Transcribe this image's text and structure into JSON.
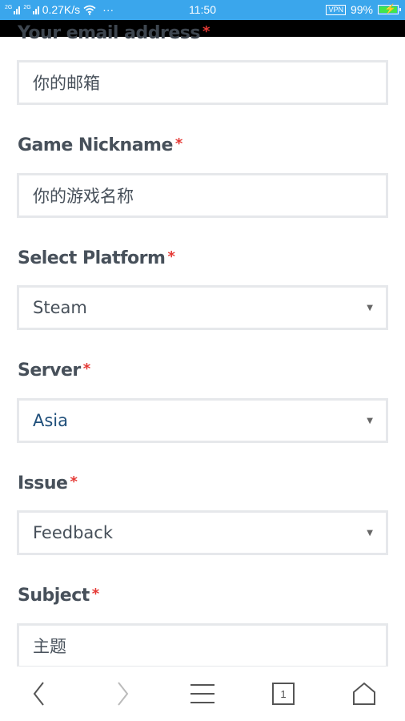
{
  "status_bar": {
    "sim1": "2G",
    "sim2": "2G",
    "network_speed": "0.27K/s",
    "more": "···",
    "time": "11:50",
    "vpn": "VPN",
    "battery": "99%"
  },
  "form": {
    "email": {
      "label": "Your email address",
      "placeholder": "你的邮箱"
    },
    "nickname": {
      "label": "Game Nickname",
      "placeholder": "你的游戏名称"
    },
    "platform": {
      "label": "Select Platform",
      "value": "Steam"
    },
    "server": {
      "label": "Server",
      "value": "Asia"
    },
    "issue": {
      "label": "Issue",
      "value": "Feedback"
    },
    "subject": {
      "label": "Subject",
      "placeholder": "主题"
    },
    "required_mark": "*"
  },
  "nav": {
    "tab_count": "1",
    "icons": [
      "back-icon",
      "forward-icon",
      "menu-icon",
      "tabs-icon",
      "home-icon"
    ]
  },
  "colors": {
    "status_bar": "#3aa6ec",
    "required": "#e53935",
    "label": "#47505a",
    "field_border": "#e6e8eb",
    "selected_server": "#1f4f7a"
  }
}
